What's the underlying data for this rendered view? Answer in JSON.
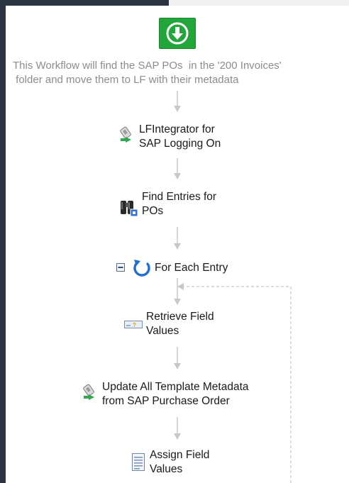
{
  "workflow": {
    "description": "This Workflow will find the SAP POs  in the '200 Invoices'\n folder and move them to LF with their metadata",
    "activities": [
      {
        "label": "LFIntegrator for\nSAP Logging On",
        "icon": "lfintegrator-icon"
      },
      {
        "label": "Find Entries for\nPOs",
        "icon": "binoculars-icon"
      },
      {
        "label": "For Each Entry",
        "icon": "loop-icon"
      },
      {
        "label": "Retrieve Field\nValues",
        "icon": "field-tag-icon"
      },
      {
        "label": "Update All Template Metadata\nfrom SAP Purchase Order",
        "icon": "lfintegrator-icon"
      },
      {
        "label": "Assign Field\nValues",
        "icon": "document-icon"
      }
    ]
  },
  "colors": {
    "start": "#22a63c",
    "frame": "#2b3440",
    "connector": "#c8c8c8",
    "loop": "#1e6fd0"
  }
}
